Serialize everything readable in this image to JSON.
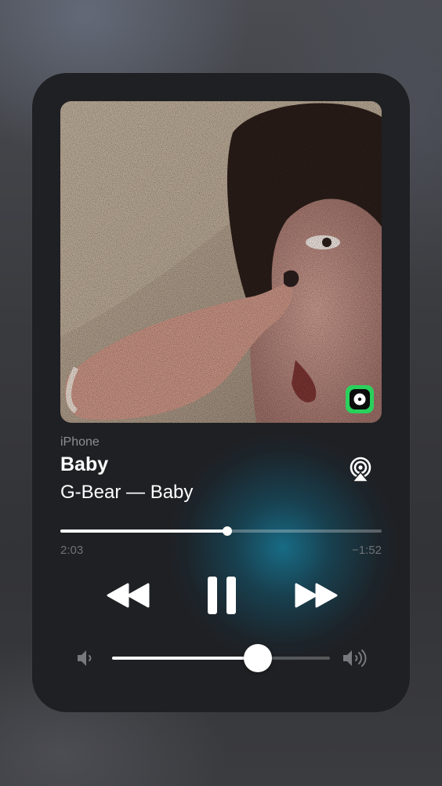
{
  "now_playing": {
    "device": "iPhone",
    "title": "Baby",
    "subtitle": "G-Bear — Baby",
    "artwork_app_icon": "music-app-icon",
    "accent_color": "#1a8fb3"
  },
  "playback": {
    "elapsed": "2:03",
    "remaining": "−1:52",
    "progress_fraction": 0.52,
    "state": "playing"
  },
  "controls": {
    "previous_icon": "rewind-icon",
    "pause_icon": "pause-icon",
    "next_icon": "fast-forward-icon",
    "airplay_icon": "airplay-icon"
  },
  "volume": {
    "level_fraction": 0.67,
    "low_icon": "speaker-low-icon",
    "high_icon": "speaker-high-icon"
  }
}
